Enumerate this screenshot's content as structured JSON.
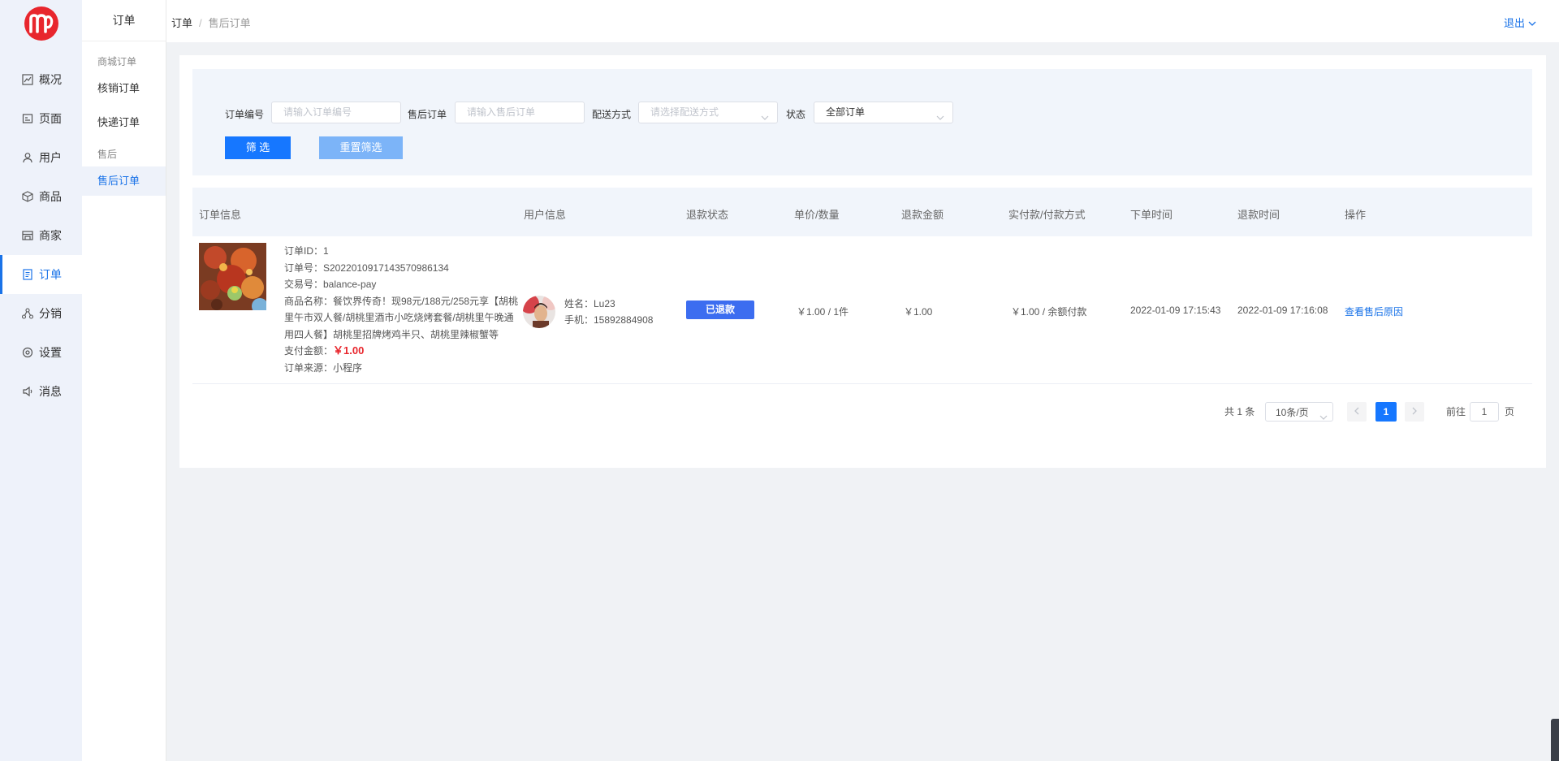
{
  "rail": {
    "items": [
      {
        "label": "概况",
        "icon": "chart-line-icon"
      },
      {
        "label": "页面",
        "icon": "page-icon"
      },
      {
        "label": "用户",
        "icon": "user-icon"
      },
      {
        "label": "商品",
        "icon": "cube-icon"
      },
      {
        "label": "商家",
        "icon": "store-icon"
      },
      {
        "label": "订单",
        "icon": "order-icon"
      },
      {
        "label": "分销",
        "icon": "share-icon"
      },
      {
        "label": "设置",
        "icon": "gear-icon"
      },
      {
        "label": "消息",
        "icon": "speaker-icon"
      }
    ],
    "active_label": "订单"
  },
  "submenu": {
    "title": "订单",
    "group1": "商城订单",
    "item1": "核销订单",
    "item2": "快递订单",
    "group2": "售后",
    "item3": "售后订单"
  },
  "header": {
    "breadcrumb_root": "订单",
    "breadcrumb_separator": "/",
    "breadcrumb_current": "售后订单",
    "logout": "退出"
  },
  "filter": {
    "order_no_label": "订单编号",
    "order_no_placeholder": "请输入订单编号",
    "aftersale_label": "售后订单",
    "aftersale_placeholder": "请输入售后订单",
    "delivery_label": "配送方式",
    "delivery_placeholder": "请选择配送方式",
    "status_label": "状态",
    "status_value": "全部订单",
    "filter_button": "筛 选",
    "reset_button": "重置筛选"
  },
  "table": {
    "columns": [
      "订单信息",
      "用户信息",
      "退款状态",
      "单价/数量",
      "退款金额",
      "实付款/付款方式",
      "下单时间",
      "退款时间",
      "操作"
    ],
    "rows": [
      {
        "order_id": "订单ID：1",
        "order_no": "订单号：S2022010917143570986134",
        "trade_no": "交易号：balance-pay",
        "goods_name": "商品名称：餐饮界传奇！现98元/188元/258元享【胡桃里午市双人餐/胡桃里酒市小吃烧烤套餐/胡桃里午晚通用四人餐】胡桃里招牌烤鸡半只、胡桃里辣椒蟹等",
        "pay_label": "支付金额：",
        "pay_amount": "￥1.00",
        "source": "订单来源：小程序",
        "user_name": "姓名：Lu23",
        "user_phone": "手机：15892884908",
        "refund_status": "已退款",
        "price_qty": "￥1.00 / 1件",
        "refund_amount": "￥1.00",
        "paid_method": "￥1.00 / 余额付款",
        "order_time": "2022-01-09 17:15:43",
        "refund_time": "2022-01-09 17:16:08",
        "action": "查看售后原因"
      }
    ]
  },
  "pager": {
    "total": "共 1 条",
    "page_size": "10条/页",
    "current_page": "1",
    "goto_label": "前往",
    "goto_value": "1",
    "page_unit": "页"
  },
  "colors": {
    "brand_red": "#e8262d",
    "primary_blue": "#1677ff",
    "link_blue": "#1a73e8",
    "tag_blue": "#3c6df0"
  }
}
